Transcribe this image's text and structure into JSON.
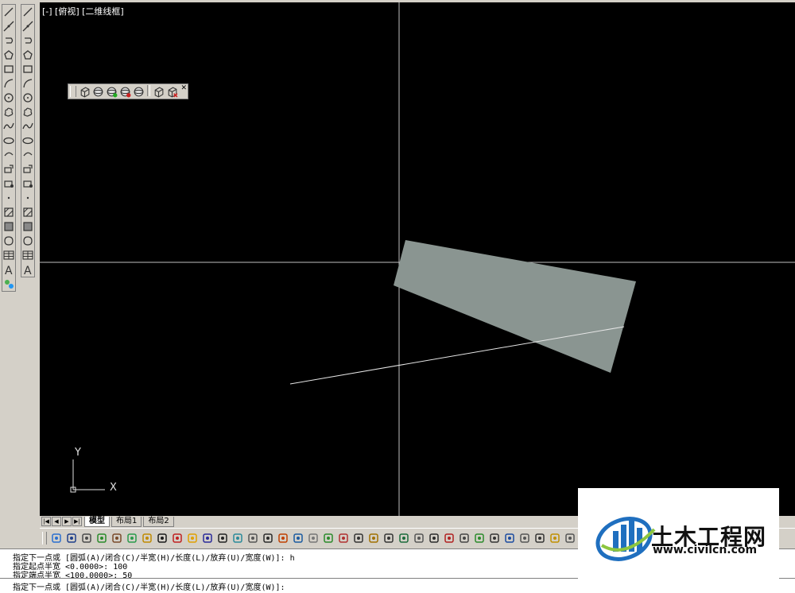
{
  "viewport_label": "[-] [俯视] [二维线框]",
  "layout_tabs": [
    "模型",
    "布局1",
    "布局2"
  ],
  "active_tab": "模型",
  "ucs": {
    "y_label": "Y",
    "x_label": "X"
  },
  "command_history": [
    "指定下一点或 [圆弧(A)/闭合(C)/半宽(H)/长度(L)/放弃(U)/宽度(W)]: h",
    "指定起点半宽 <0.0000>: 100",
    "指定端点半宽 <100.0000>: 50"
  ],
  "command_prompt": "指定下一点或 [圆弧(A)/闭合(C)/半宽(H)/长度(L)/放弃(U)/宽度(W)]:",
  "watermark": {
    "title": "土木工程网",
    "url": "www.civilcn.com"
  },
  "draw_toolbar_icons": [
    "line-icon",
    "construction-line-icon",
    "polyline-icon",
    "polygon-icon",
    "rectangle-icon",
    "arc-icon",
    "circle-icon",
    "revision-cloud-icon",
    "spline-icon",
    "ellipse-icon",
    "ellipse-arc-icon",
    "insert-block-icon",
    "make-block-icon",
    "point-icon",
    "hatch-icon",
    "gradient-icon",
    "region-icon",
    "table-icon",
    "text-icon"
  ],
  "floating_toolbar_icons": [
    "3d-box-icon",
    "sphere-icon",
    "sphere-add-icon",
    "sphere-remove-icon",
    "orbit-icon",
    "3d-view-icon",
    "3d-delete-icon"
  ],
  "colors": {
    "canvas": "#000000",
    "crosshair": "#c0c0c0",
    "polyline_fill": "#8a9591",
    "ui_gray": "#d4d0c8"
  }
}
